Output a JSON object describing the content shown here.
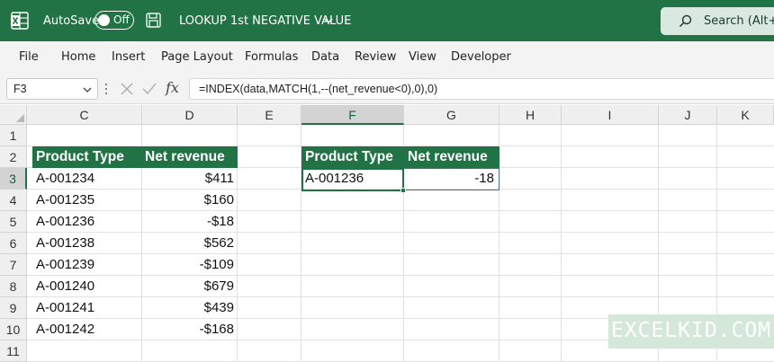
{
  "titlebar": {
    "autosave_label": "AutoSave",
    "autosave_state": "Off",
    "document_title": "LOOKUP 1st NEGATIVE VALUE",
    "search_label": "Search (Alt+Q)"
  },
  "menu": {
    "items": [
      "File",
      "Home",
      "Insert",
      "Page Layout",
      "Formulas",
      "Data",
      "Review",
      "View",
      "Developer"
    ]
  },
  "formula_bar": {
    "name_box": "F3",
    "fx_label": "fx",
    "formula": "=INDEX(data,MATCH(1,--(net_revenue<0),0),0)"
  },
  "grid": {
    "columns": [
      "C",
      "D",
      "E",
      "F",
      "G",
      "H",
      "I",
      "J",
      "K"
    ],
    "rows": [
      "1",
      "2",
      "3",
      "4",
      "5",
      "6",
      "7",
      "8",
      "9",
      "10",
      "11"
    ],
    "selected_column": "F",
    "selected_row": "3"
  },
  "source_table": {
    "headers": [
      "Product Type",
      "Net revenue"
    ],
    "rows": [
      [
        "A-001234",
        "$411"
      ],
      [
        "A-001235",
        "$160"
      ],
      [
        "A-001236",
        "-$18"
      ],
      [
        "A-001238",
        "$562"
      ],
      [
        "A-001239",
        "-$109"
      ],
      [
        "A-001240",
        "$679"
      ],
      [
        "A-001241",
        "$439"
      ],
      [
        "A-001242",
        "-$168"
      ]
    ]
  },
  "result_table": {
    "headers": [
      "Product Type",
      "Net revenue"
    ],
    "row": [
      "A-001236",
      "-18"
    ]
  },
  "watermark": "EXCELKID.COM",
  "colors": {
    "excel_green": "#217346",
    "header_fill": "#217346",
    "selection_blue": "#3a6fb0"
  }
}
